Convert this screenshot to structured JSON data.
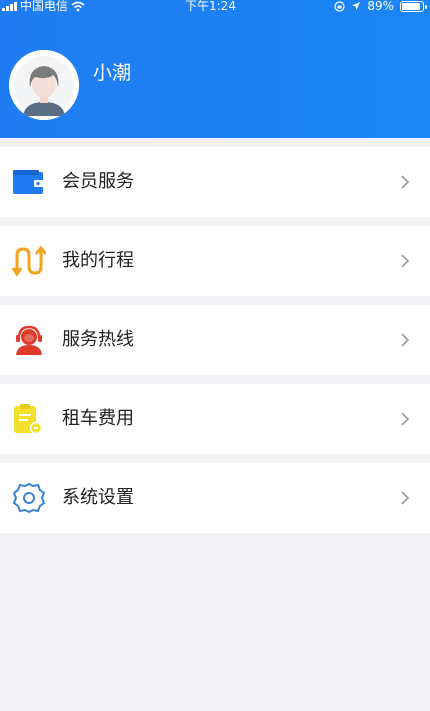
{
  "status_bar": {
    "carrier": "中国电信",
    "time": "下午1:24",
    "battery": "89%",
    "battery_level": 0.89
  },
  "profile": {
    "username": "小潮"
  },
  "menu": [
    {
      "label": "会员服务",
      "icon": "wallet-icon",
      "color": "#1f7cf2"
    },
    {
      "label": "我的行程",
      "icon": "route-arrows-icon",
      "color": "#f3a41c"
    },
    {
      "label": "服务热线",
      "icon": "customer-service-icon",
      "color": "#e03a2a"
    },
    {
      "label": "租车费用",
      "icon": "bill-icon",
      "color": "#f2e02c"
    },
    {
      "label": "系统设置",
      "icon": "gear-icon",
      "color": "#3a82d4"
    }
  ],
  "colors": {
    "header": "#1f7cf2",
    "background": "#f2f2f4"
  }
}
